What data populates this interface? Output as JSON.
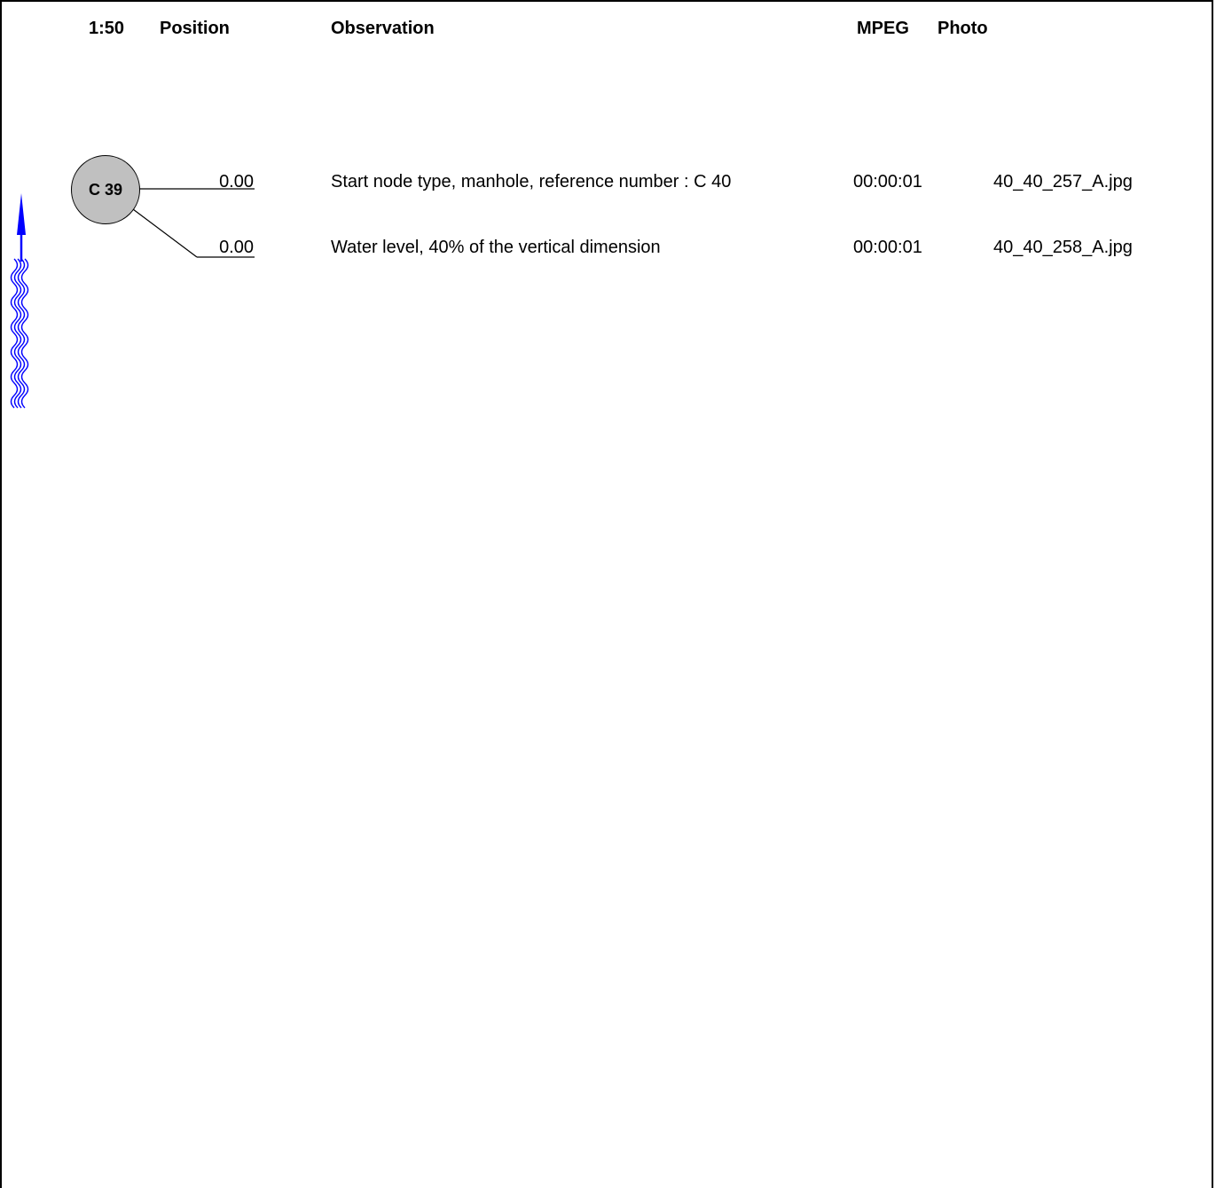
{
  "header": {
    "scale": "1:50",
    "position": "Position",
    "observation": "Observation",
    "mpeg": "MPEG",
    "photo": "Photo"
  },
  "node": {
    "label": "C 39"
  },
  "rows": [
    {
      "position": "0.00",
      "observation": "Start node type, manhole, reference number :  C 40",
      "mpeg": "00:00:01",
      "photo": "40_40_257_A.jpg"
    },
    {
      "position": "0.00",
      "observation": "Water level, 40% of the vertical dimension",
      "mpeg": "00:00:01",
      "photo": "40_40_258_A.jpg"
    }
  ],
  "colors": {
    "flow_arrow": "#0000ff",
    "node_fill": "#c0c0c0"
  },
  "icons": {
    "flow": "flow-direction-arrow-icon",
    "water": "water-wave-icon"
  }
}
